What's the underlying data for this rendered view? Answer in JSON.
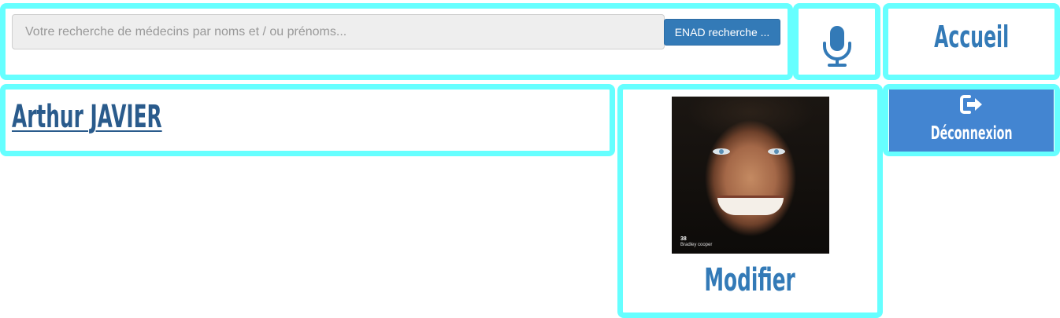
{
  "search": {
    "placeholder": "Votre recherche de médecins par noms et / ou prénoms...",
    "button_label": "ENAD recherche ..."
  },
  "nav": {
    "home_label": "Accueil",
    "logout_label": "Déconnexion"
  },
  "user": {
    "name": "Arthur JAVIER",
    "photo_caption_number": "38",
    "photo_caption_text": "Bradley cooper",
    "modify_label": "Modifier"
  },
  "icons": {
    "mic": "microphone-icon",
    "logout": "sign-out-icon"
  },
  "colors": {
    "border_accent": "#66ffff",
    "primary": "#337ab7",
    "logout_button": "#4385d1",
    "name_link": "#2a5b8c"
  }
}
